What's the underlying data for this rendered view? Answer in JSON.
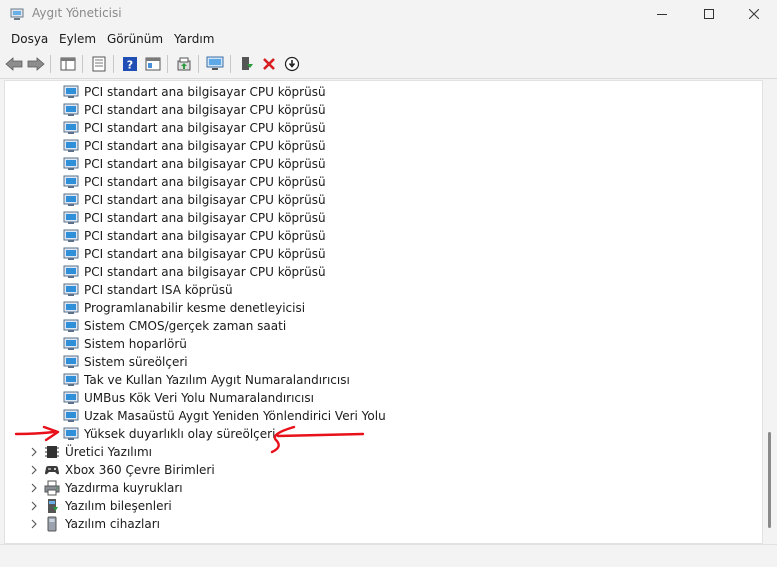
{
  "window": {
    "title": "Aygıt Yöneticisi"
  },
  "menu": [
    "Dosya",
    "Eylem",
    "Görünüm",
    "Yardım"
  ],
  "tree": {
    "children": [
      "PCI standart ana bilgisayar CPU köprüsü",
      "PCI standart ana bilgisayar CPU köprüsü",
      "PCI standart ana bilgisayar CPU köprüsü",
      "PCI standart ana bilgisayar CPU köprüsü",
      "PCI standart ana bilgisayar CPU köprüsü",
      "PCI standart ana bilgisayar CPU köprüsü",
      "PCI standart ana bilgisayar CPU köprüsü",
      "PCI standart ana bilgisayar CPU köprüsü",
      "PCI standart ana bilgisayar CPU köprüsü",
      "PCI standart ana bilgisayar CPU köprüsü",
      "PCI standart ana bilgisayar CPU köprüsü",
      "PCI standart ISA köprüsü",
      "Programlanabilir kesme denetleyicisi",
      "Sistem CMOS/gerçek zaman saati",
      "Sistem hoparlörü",
      "Sistem süreölçeri",
      "Tak ve Kullan Yazılım Aygıt Numaralandırıcısı",
      "UMBus Kök Veri Yolu Numaralandırıcısı",
      "Uzak Masaüstü Aygıt Yeniden Yönlendirici Veri Yolu",
      "Yüksek duyarlıklı olay süreölçeri"
    ],
    "categories": [
      {
        "label": "Üretici Yazılımı",
        "icon": "firmware-chip-icon"
      },
      {
        "label": "Xbox 360 Çevre Birimleri",
        "icon": "gamepad-icon"
      },
      {
        "label": "Yazdırma kuyrukları",
        "icon": "printer-icon"
      },
      {
        "label": "Yazılım bileşenleri",
        "icon": "software-component-icon"
      },
      {
        "label": "Yazılım cihazları",
        "icon": "software-device-icon"
      }
    ]
  },
  "colors": {
    "annotation": "#e8101a",
    "device_icon": "#2f8fd8"
  }
}
